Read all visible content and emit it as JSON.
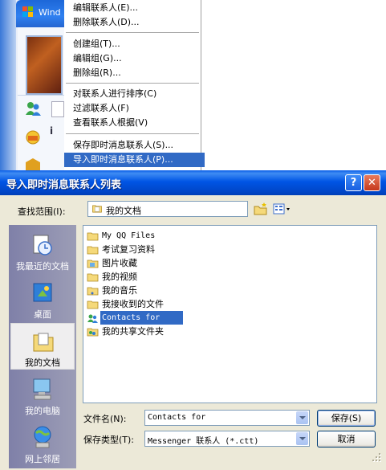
{
  "background_window": {
    "title_partial": "Wind"
  },
  "context_menu": {
    "items": [
      {
        "label": "编辑联系人(E)..."
      },
      {
        "label": "删除联系人(D)..."
      },
      {
        "label": "创建组(T)..."
      },
      {
        "label": "编辑组(G)..."
      },
      {
        "label": "删除组(R)..."
      },
      {
        "label": "对联系人进行排序(C)"
      },
      {
        "label": "过滤联系人(F)"
      },
      {
        "label": "查看联系人根据(V)"
      },
      {
        "label": "保存即时消息联系人(S)..."
      },
      {
        "label": "导入即时消息联系人(P)..."
      }
    ],
    "selected_index": 9
  },
  "dialog": {
    "title": "导入即时消息联系人列表",
    "help_label": "?",
    "close_label": "✕",
    "look_in_label": "查找范围(I):",
    "look_in_value": "我的文档",
    "places": [
      {
        "label": "我最近的文档",
        "icon": "recent-documents-icon"
      },
      {
        "label": "桌面",
        "icon": "desktop-icon"
      },
      {
        "label": "我的文档",
        "icon": "my-documents-icon"
      },
      {
        "label": "我的电脑",
        "icon": "my-computer-icon"
      },
      {
        "label": "网上邻居",
        "icon": "network-places-icon"
      }
    ],
    "active_place_index": 2,
    "files": [
      {
        "name": "My QQ Files",
        "icon": "folder-icon"
      },
      {
        "name": "考试复习资料",
        "icon": "folder-icon"
      },
      {
        "name": "图片收藏",
        "icon": "pictures-folder-icon"
      },
      {
        "name": "我的视频",
        "icon": "folder-icon"
      },
      {
        "name": "我的音乐",
        "icon": "music-folder-icon"
      },
      {
        "name": "我接收到的文件",
        "icon": "folder-icon"
      },
      {
        "name": "Contacts for",
        "icon": "contacts-file-icon"
      },
      {
        "name": "我的共享文件夹",
        "icon": "shared-folder-icon"
      }
    ],
    "selected_file_index": 6,
    "filename_label": "文件名(N):",
    "filename_value": "Contacts for",
    "filetype_label": "保存类型(T):",
    "filetype_value": "Messenger 联系人 (*.ctt)",
    "save_label": "保存(S)",
    "cancel_label": "取消"
  }
}
